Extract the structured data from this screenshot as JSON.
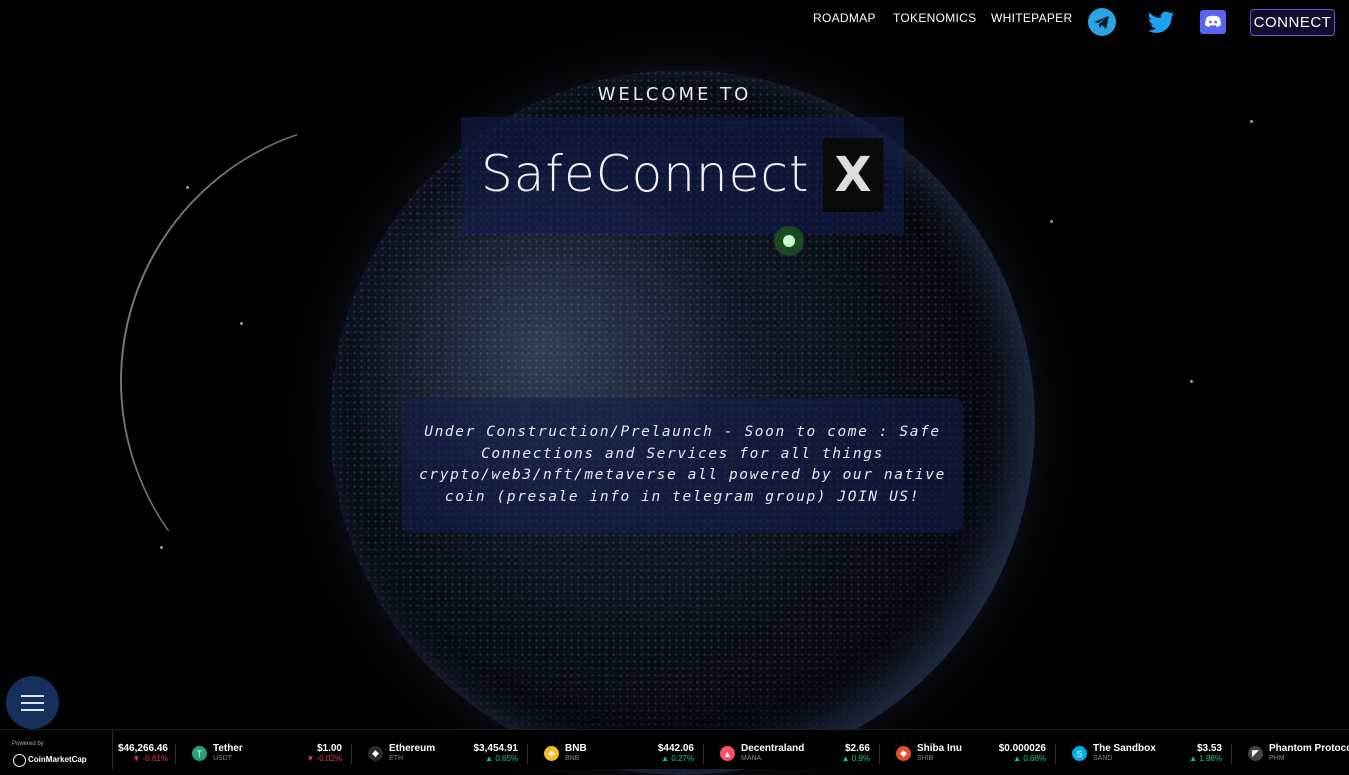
{
  "nav": {
    "roadmap": "ROADMAP",
    "tokenomics": "TOKENOMICS",
    "whitepaper": "WHITEPAPER",
    "connect": "CONNECT",
    "icons": [
      "telegram-icon",
      "twitter-icon",
      "discord-icon"
    ]
  },
  "hero": {
    "welcome": "WELCOME TO",
    "title": "SafeConnect",
    "title_mark": "X",
    "description": "Under Construction/Prelaunch - Soon to come : Safe Connections and Services for all things crypto/web3/nft/metaverse all powered by our native coin (presale info in telegram group) JOIN US!"
  },
  "ticker": {
    "powered_by": "Powered by",
    "provider": "CoinMarketCap",
    "first_price": "$46,266.46",
    "first_change": "0.61%",
    "items": [
      {
        "name": "Tether",
        "symbol": "USDT",
        "price": "$1.00",
        "change": "0.02%",
        "dir": "down",
        "icon_color": "#26a17b",
        "icon": "T"
      },
      {
        "name": "Ethereum",
        "symbol": "ETH",
        "price": "$3,454.91",
        "change": "0.65%",
        "dir": "up",
        "icon_color": "#2b2b2b",
        "icon": "◆"
      },
      {
        "name": "BNB",
        "symbol": "BNB",
        "price": "$442.06",
        "change": "0.27%",
        "dir": "up",
        "icon_color": "#f3ba2f",
        "icon": "◈"
      },
      {
        "name": "Decentraland",
        "symbol": "MANA",
        "price": "$2.66",
        "change": "0.9%",
        "dir": "up",
        "icon_color": "#ff4d6d",
        "icon": "▲"
      },
      {
        "name": "Shiba Inu",
        "symbol": "SHIB",
        "price": "$0.000026",
        "change": "0.68%",
        "dir": "up",
        "icon_color": "#e0502b",
        "icon": "◆"
      },
      {
        "name": "The Sandbox",
        "symbol": "SAND",
        "price": "$3.53",
        "change": "1.98%",
        "dir": "up",
        "icon_color": "#00adef",
        "icon": "S"
      },
      {
        "name": "Phantom Protocol",
        "symbol": "PHM",
        "price": "",
        "change": "",
        "dir": "up",
        "icon_color": "#444",
        "icon": "◤"
      }
    ]
  },
  "colors": {
    "background": "#000000",
    "accent": "#6a5acd",
    "up": "#16c784",
    "down": "#ea3943"
  }
}
